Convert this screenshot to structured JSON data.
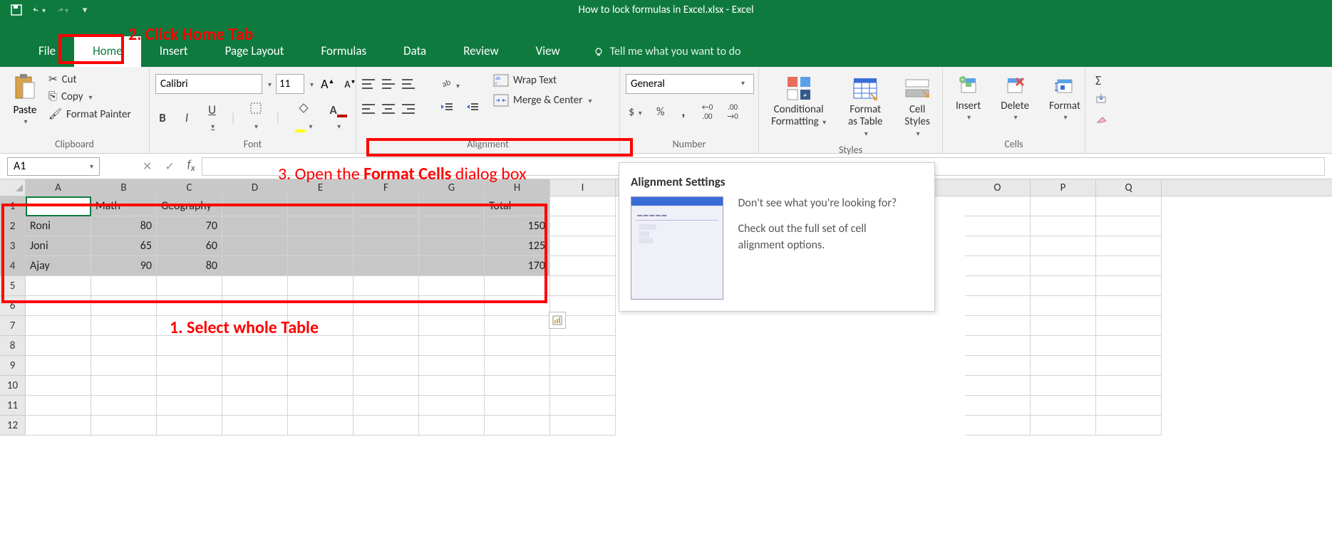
{
  "titlebar": {
    "title": "How to lock formulas in Excel.xlsx  -  Excel"
  },
  "tabs": {
    "file": "File",
    "home": "Home",
    "insert": "Insert",
    "pagelayout": "Page Layout",
    "formulas": "Formulas",
    "data": "Data",
    "review": "Review",
    "view": "View",
    "tellme": "Tell me what you want to do"
  },
  "ribbon": {
    "clipboard": {
      "label": "Clipboard",
      "paste": "Paste",
      "cut": "Cut",
      "copy": "Copy",
      "painter": "Format Painter"
    },
    "font": {
      "label": "Font",
      "name": "Calibri",
      "size": "11",
      "bold": "B",
      "italic": "I",
      "underline": "U"
    },
    "alignment": {
      "label": "Alignment",
      "wrap": "Wrap Text",
      "merge": "Merge & Center"
    },
    "number": {
      "label": "Number",
      "format": "General",
      "currency": "$",
      "percent": "%",
      "comma": ","
    },
    "styles": {
      "label": "Styles",
      "cond": "Conditional Formatting",
      "table": "Format as Table",
      "cell": "Cell Styles"
    },
    "cells": {
      "label": "Cells",
      "insert": "Insert",
      "delete": "Delete",
      "format": "Format"
    }
  },
  "namebox": "A1",
  "tooltip": {
    "title": "Alignment Settings",
    "line1": "Don't see what you're looking for?",
    "line2": "Check out the full set of cell alignment options."
  },
  "annotations": {
    "step1": "1. Select whole Table",
    "step2": "2. Click Home Tab",
    "step3a": "3. Open the ",
    "step3b": "Format Cells",
    "step3c": " dialog box"
  },
  "columns": [
    "A",
    "B",
    "C",
    "D",
    "E",
    "F",
    "G",
    "H",
    "I",
    "O",
    "P",
    "Q"
  ],
  "headers": {
    "math": "Math",
    "geo": "Geography",
    "total": "Total"
  },
  "data_rows": [
    {
      "name": "Roni",
      "math": "80",
      "geo": "70",
      "total": "150"
    },
    {
      "name": "Joni",
      "math": "65",
      "geo": "60",
      "total": "125"
    },
    {
      "name": "Ajay",
      "math": "90",
      "geo": "80",
      "total": "170"
    }
  ],
  "chart_data": {
    "type": "table",
    "columns": [
      "",
      "Math",
      "Geography",
      "Total"
    ],
    "rows": [
      [
        "Roni",
        80,
        70,
        150
      ],
      [
        "Joni",
        65,
        60,
        125
      ],
      [
        "Ajay",
        90,
        80,
        170
      ]
    ]
  }
}
